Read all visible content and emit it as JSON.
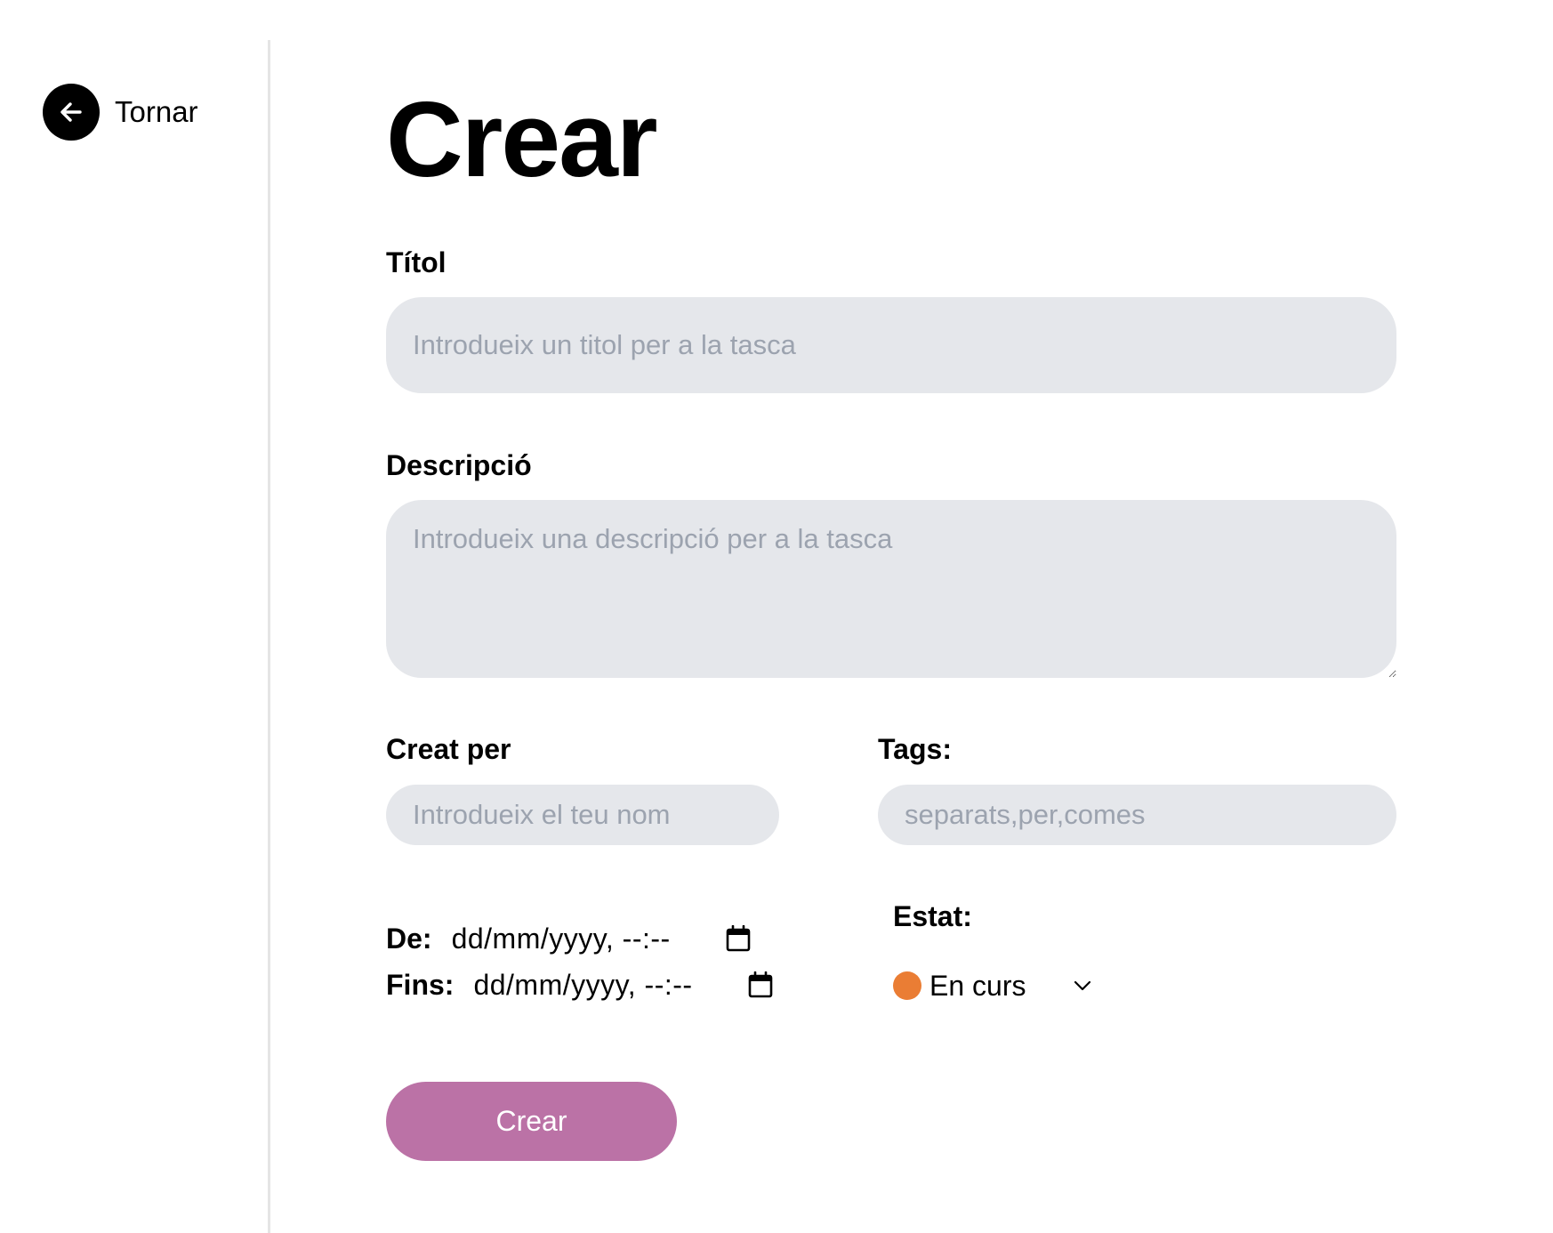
{
  "back": {
    "label": "Tornar",
    "icon": "arrow-left-icon"
  },
  "page": {
    "title": "Crear"
  },
  "form": {
    "title": {
      "label": "Títol",
      "value": "",
      "placeholder": "Introdueix un titol per a la tasca"
    },
    "description": {
      "label": "Descripció",
      "value": "",
      "placeholder": "Introdueix una descripció per a la tasca"
    },
    "created_by": {
      "label": "Creat per",
      "value": "",
      "placeholder": "Introdueix el teu nom"
    },
    "tags": {
      "label": "Tags:",
      "value": "",
      "placeholder": "separats,per,comes"
    },
    "from": {
      "label": "De:",
      "value": "dd/mm/yyyy, --:--",
      "icon": "calendar-icon"
    },
    "until": {
      "label": "Fins:",
      "value": "dd/mm/yyyy, --:--",
      "icon": "calendar-icon"
    },
    "status": {
      "label": "Estat:",
      "selected": "En curs",
      "color": "#ea7d34",
      "icon": "chevron-down-icon"
    },
    "submit_label": "Crear"
  },
  "colors": {
    "accent": "#bb72a6",
    "field_bg": "#e5e7eb",
    "status_in_progress": "#ea7d34"
  }
}
